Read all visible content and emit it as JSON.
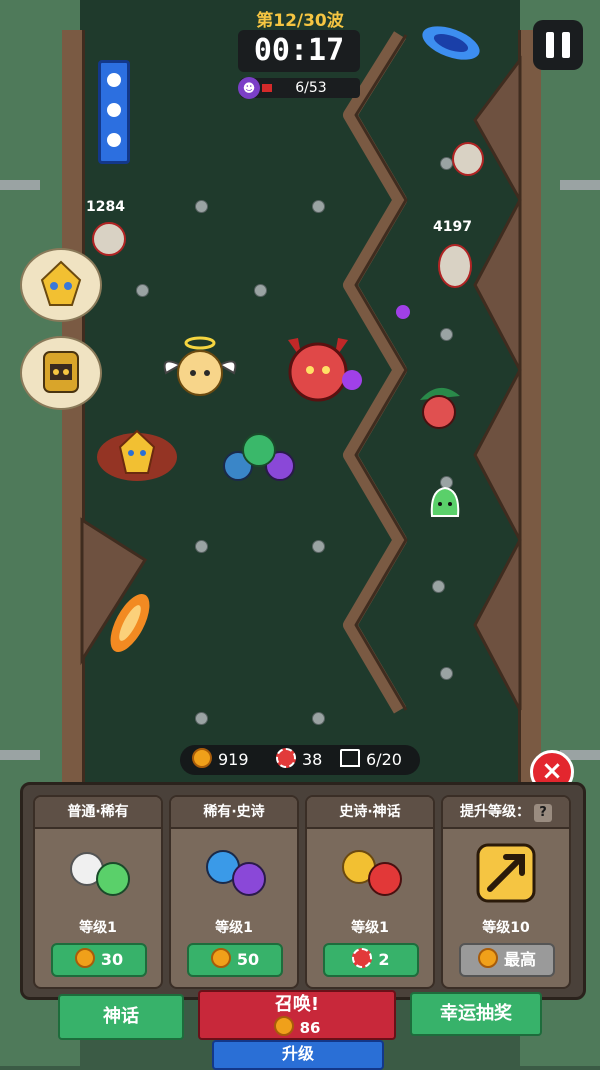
{
  "hud": {
    "wave": "第12/30波",
    "timer": "00:17",
    "enemy_count": "6/53",
    "enemy_progress": 0.113
  },
  "field": {
    "hp_left": "1284",
    "hp_right": "4197"
  },
  "resources": {
    "coins": "919",
    "chips": "38",
    "units": "6/20"
  },
  "cards": [
    {
      "title": "普通·稀有",
      "level": "等级1",
      "cost": "30",
      "cost_icon": "coin-icon"
    },
    {
      "title": "稀有·史诗",
      "level": "等级1",
      "cost": "50",
      "cost_icon": "coin-icon"
    },
    {
      "title": "史诗·神话",
      "level": "等级1",
      "cost": "2",
      "cost_icon": "chip-icon"
    },
    {
      "title": "提升等级：",
      "help": "?",
      "level": "等级10",
      "cost": "最高",
      "cost_icon": "coin-icon"
    }
  ],
  "bottom": {
    "myth_label": "神话",
    "summon_label": "召唤!",
    "summon_cost": "86",
    "lucky_label": "幸运抽奖",
    "upgrade_label": "升级"
  },
  "colors": {
    "gold": "#f5c542",
    "green_btn": "#37b26a",
    "red_btn": "#c8283a",
    "blue_btn": "#2a6fd6"
  }
}
